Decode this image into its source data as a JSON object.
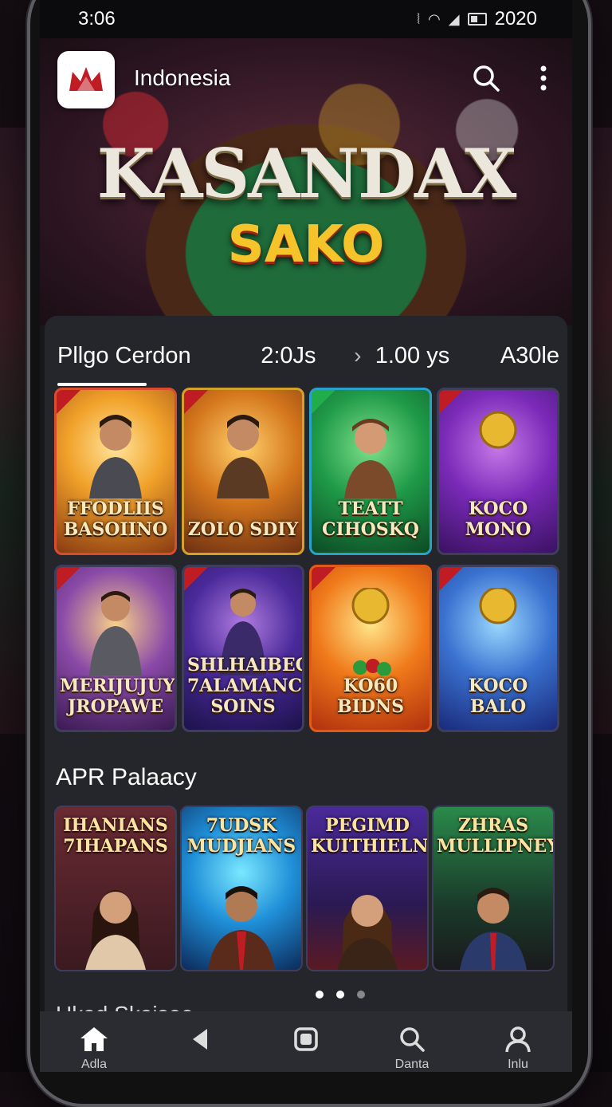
{
  "status_bar": {
    "time": "3:06",
    "right_text": "2020"
  },
  "header": {
    "region": "Indonesia"
  },
  "hero": {
    "title": "KASANDAX",
    "subtitle": "SAKO"
  },
  "filter": {
    "label": "Pllgo Cerdon",
    "time": "2:0Js",
    "chevron": "›",
    "duration": "1.00 ys",
    "extra": "A30le"
  },
  "game_tiles": [
    {
      "name": "FFODLIIS BASOIINO"
    },
    {
      "name": "ZOLO SDIY"
    },
    {
      "name": "TEATT CIHOSKQ"
    },
    {
      "name": "KOCO MONO"
    },
    {
      "name": "MERIJUJUY JROPAWE"
    },
    {
      "name": "SHLHAIBEC 7ALAMANC SOINS"
    },
    {
      "name": "KO60 BIDNS"
    },
    {
      "name": "KOCO BALO"
    }
  ],
  "section": {
    "title": "APR Palaacy"
  },
  "promos": [
    {
      "name": "IHANIANS 7IHAPANS"
    },
    {
      "name": "7UDSK MUDJIANS"
    },
    {
      "name": "PEGIMD KUITHIELN"
    },
    {
      "name": "ZHRAS MULLIPNEY"
    }
  ],
  "next_section": {
    "title": "Ukad Skaisee"
  },
  "nav": {
    "items": [
      {
        "label": "Adla",
        "icon": "home-icon"
      },
      {
        "label": "",
        "icon": "back-icon"
      },
      {
        "label": "",
        "icon": "square-icon"
      },
      {
        "label": "Danta",
        "icon": "search-icon"
      },
      {
        "label": "Inlu",
        "icon": "profile-icon"
      }
    ]
  },
  "colors": {
    "accent_gold": "#f5c32a",
    "panel": "#24262b",
    "nav": "#2b2c31"
  }
}
